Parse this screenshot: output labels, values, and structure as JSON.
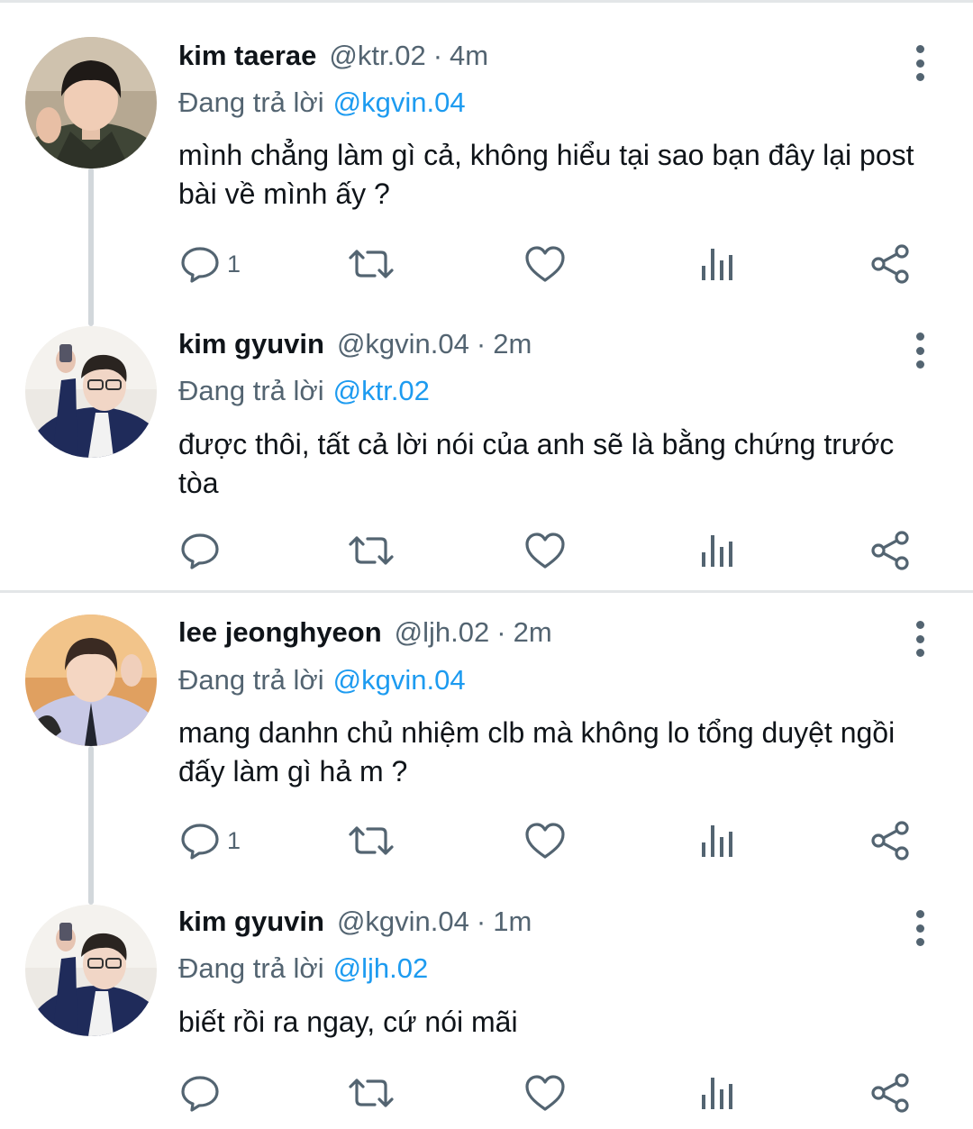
{
  "colors": {
    "mention": "#1d9bf0",
    "secondary": "#536471",
    "text": "#0f1419",
    "divider": "#e3e6e8",
    "thread_line": "#d2d7db"
  },
  "reply_prefix": "Đang trả lời",
  "icons": [
    "reply-icon",
    "retweet-icon",
    "like-icon",
    "analytics-icon",
    "share-icon",
    "more-options-icon"
  ],
  "tweets": [
    {
      "name": "kim taerae",
      "handle": "@ktr.02",
      "sep": "·",
      "time": "4m",
      "reply_to": "@kgvin.04",
      "text": "mình chẳng làm gì cả, không hiểu tại sao bạn đây lại post bài về mình ấy ?",
      "replies": "1"
    },
    {
      "name": "kim gyuvin",
      "handle": "@kgvin.04",
      "sep": "·",
      "time": "2m",
      "reply_to": "@ktr.02",
      "text": "được thôi, tất cả lời nói của anh sẽ là bằng chứng trước tòa",
      "replies": ""
    },
    {
      "name": "lee jeonghyeon",
      "handle": "@ljh.02",
      "sep": "·",
      "time": "2m",
      "reply_to": "@kgvin.04",
      "text": "mang danhn chủ nhiệm clb mà không lo tổng duyệt ngồi đấy làm gì hả m ?",
      "replies": "1"
    },
    {
      "name": "kim gyuvin",
      "handle": "@kgvin.04",
      "sep": "·",
      "time": "1m",
      "reply_to": "@ljh.02",
      "text": "biết rồi ra ngay, cứ nói mãi",
      "replies": ""
    }
  ]
}
